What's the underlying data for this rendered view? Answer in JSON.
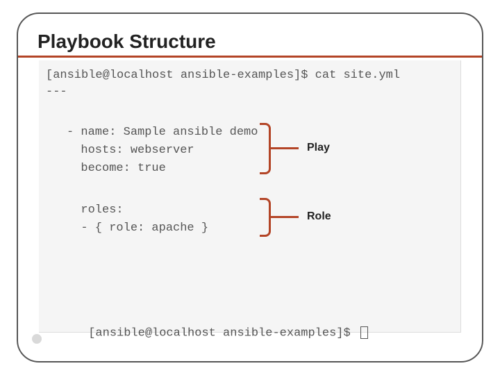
{
  "title": "Playbook Structure",
  "prompt1": "[ansible@localhost ansible-examples]$ cat site.yml",
  "prompt2": "[ansible@localhost ansible-examples]$ ",
  "yaml": {
    "line_dashes": "---",
    "play_name": "- name: Sample ansible demo",
    "play_hosts": "  hosts: webserver",
    "play_become": "  become: true",
    "roles_header": "  roles:",
    "roles_item": "  - { role: apache }"
  },
  "annotations": {
    "play": "Play",
    "role": "Role"
  }
}
